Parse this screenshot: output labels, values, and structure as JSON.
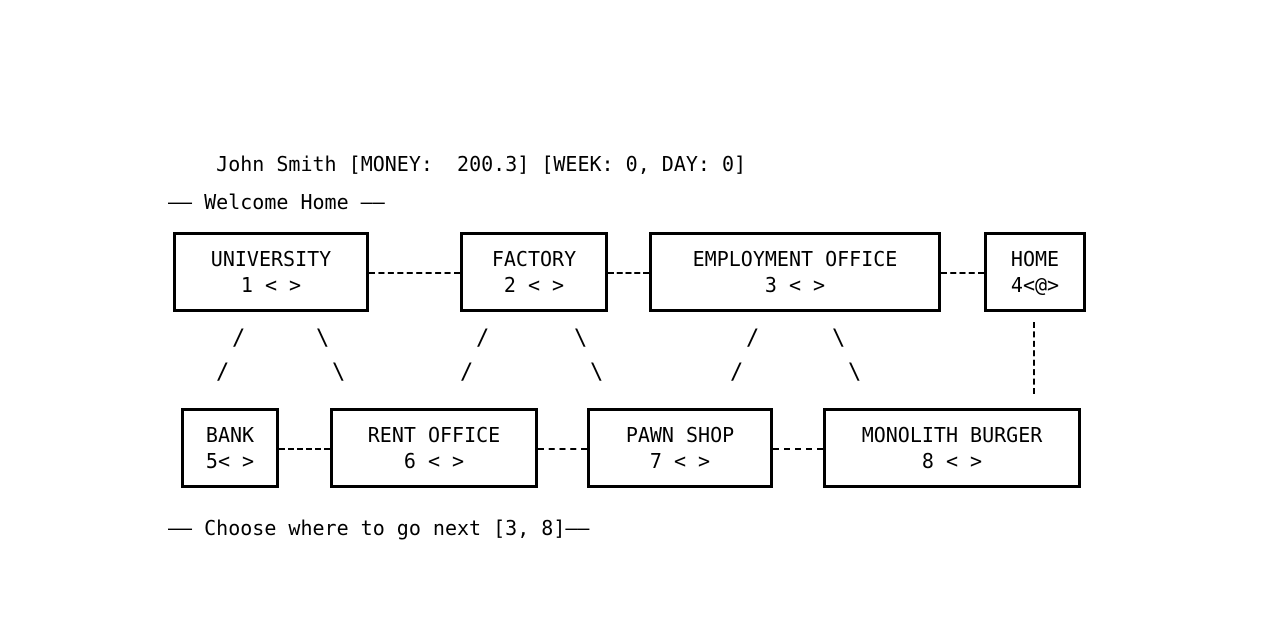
{
  "status": {
    "player_name": "John Smith",
    "money_label": "MONEY",
    "money_value": "200.3",
    "week_label": "WEEK",
    "week_value": "0",
    "day_label": "DAY",
    "day_value": "0"
  },
  "messages": {
    "welcome": "—— Welcome Home ——",
    "prompt_prefix": "—— Choose where to go next [",
    "prompt_low": "3",
    "prompt_high": "8",
    "prompt_suffix": "]——"
  },
  "locations": {
    "top": [
      {
        "name": "UNIVERSITY",
        "code": "1 < >"
      },
      {
        "name": "FACTORY",
        "code": "2 < >"
      },
      {
        "name": "EMPLOYMENT OFFICE",
        "code": "3 < >"
      },
      {
        "name": "HOME",
        "code": "4<@>"
      }
    ],
    "bottom": [
      {
        "name": "BANK",
        "code": "5< >"
      },
      {
        "name": "RENT OFFICE",
        "code": "6 < >"
      },
      {
        "name": "PAWN SHOP",
        "code": "7 < >"
      },
      {
        "name": "MONOLITH BURGER",
        "code": "8 < >"
      }
    ]
  }
}
